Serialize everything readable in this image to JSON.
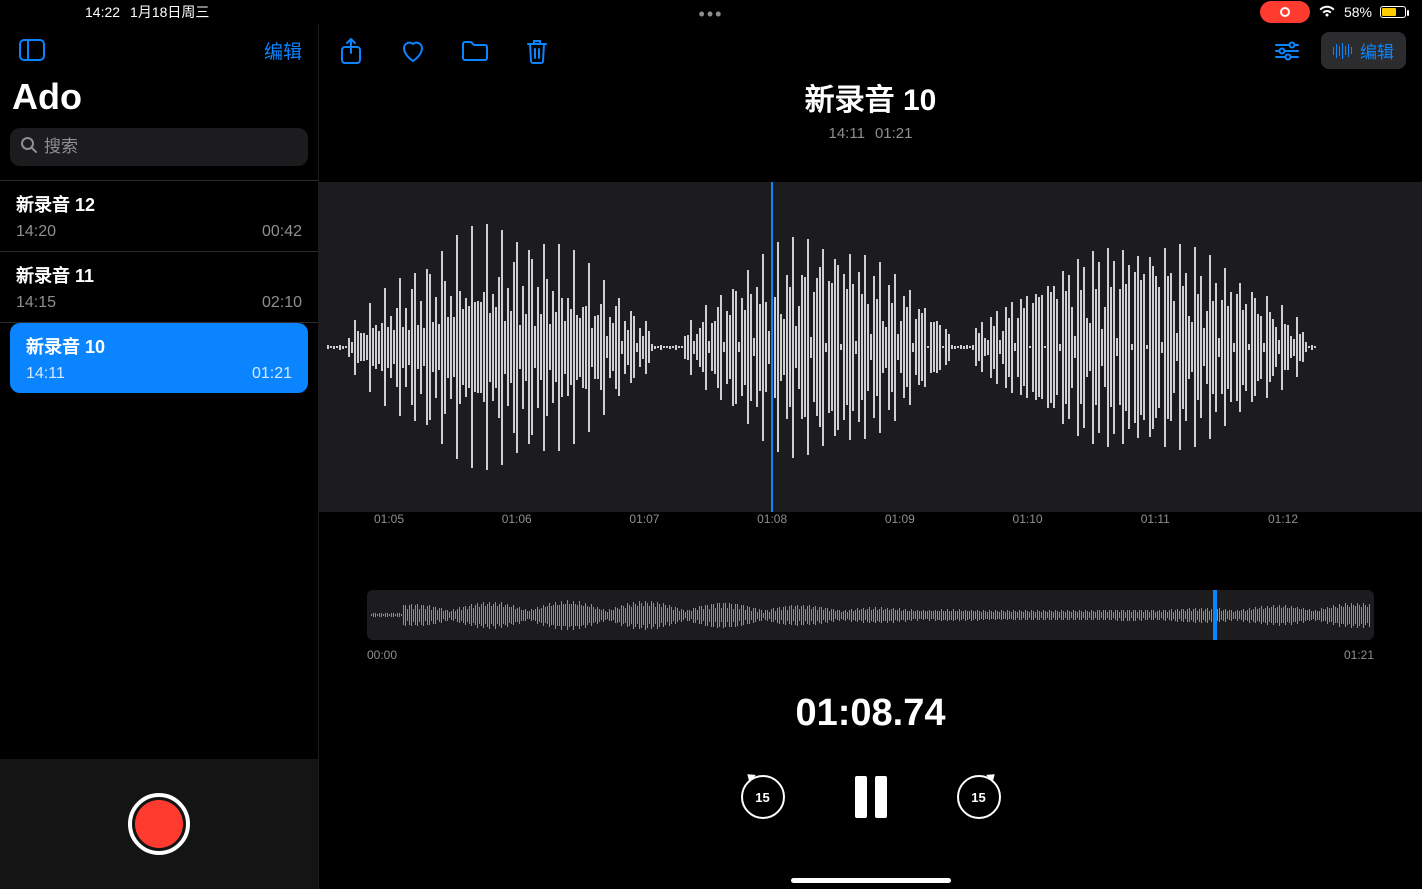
{
  "status": {
    "time": "14:22",
    "date": "1月18日周三",
    "battery_pct": "58%"
  },
  "sidebar": {
    "edit_label": "编辑",
    "title": "Ado",
    "search_placeholder": "搜索",
    "items": [
      {
        "title": "新录音 12",
        "time": "14:20",
        "duration": "00:42"
      },
      {
        "title": "新录音 11",
        "time": "14:15",
        "duration": "02:10"
      },
      {
        "title": "新录音 10",
        "time": "14:11",
        "duration": "01:21"
      }
    ]
  },
  "main": {
    "edit_label": "编辑",
    "title": "新录音 10",
    "sub_time": "14:11",
    "sub_duration": "01:21",
    "ticks": [
      "01:05",
      "01:06",
      "01:07",
      "01:08",
      "01:09",
      "01:10",
      "01:11",
      "01:12"
    ],
    "overview_start": "00:00",
    "overview_end": "01:21",
    "current_time": "01:08.74",
    "skip_amount": "15"
  }
}
